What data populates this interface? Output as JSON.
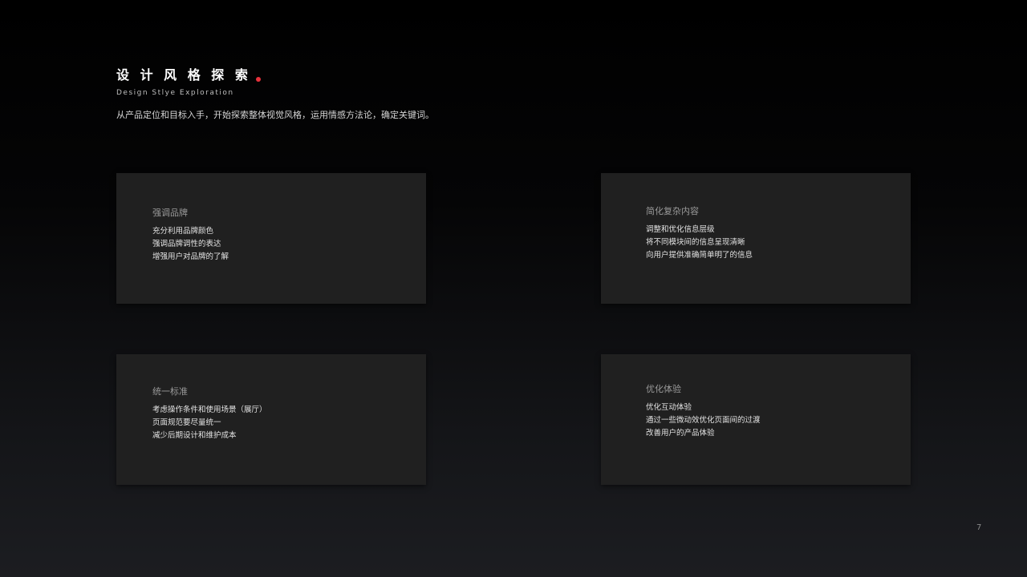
{
  "header": {
    "title": "设 计 风 格 探 索",
    "subtitle": "Design Stlye Exploration",
    "accent_color": "#e8323c"
  },
  "description": "从产品定位和目标入手，开始探索整体视觉风格，运用情感方法论，确定关键词。",
  "cards": [
    {
      "title": "强调品牌",
      "lines": [
        "充分利用品牌颜色",
        "强调品牌调性的表达",
        "增强用户对品牌的了解"
      ]
    },
    {
      "title": "简化复杂内容",
      "lines": [
        "调整和优化信息层级",
        "将不同模块间的信息呈现清晰",
        "向用户提供准确简单明了的信息"
      ]
    },
    {
      "title": "统一标准",
      "lines": [
        "考虑操作条件和使用场景（展厅）",
        "页面规范要尽量统一",
        "减少后期设计和维护成本"
      ]
    },
    {
      "title": "优化体验",
      "lines": [
        "优化互动体验",
        "通过一些微动效优化页面间的过渡",
        "改善用户的产品体验"
      ]
    }
  ],
  "page_number": "7"
}
